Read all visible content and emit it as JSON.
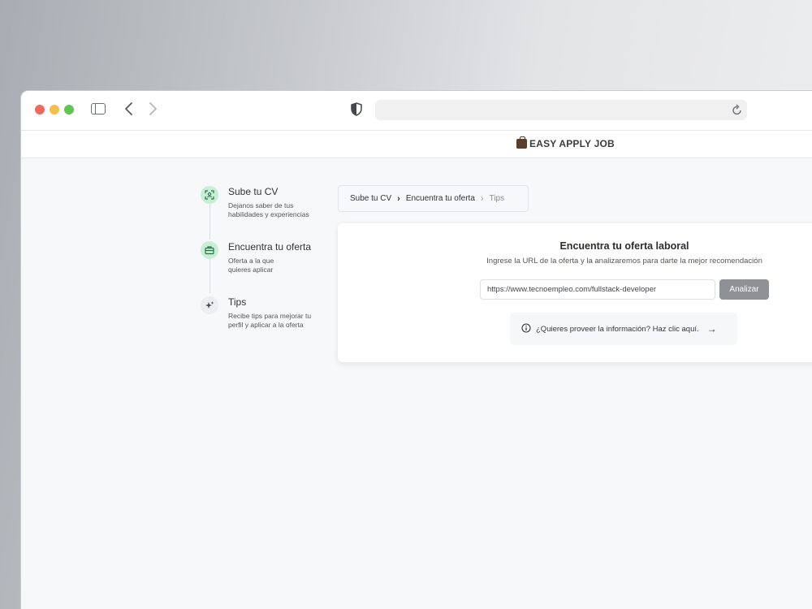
{
  "app": {
    "brand": "EASY APPLY JOB"
  },
  "steps": [
    {
      "title": "Sube tu CV",
      "desc_line1": "Dejanos saber de tus",
      "desc_line2": "habilidades y experiencias",
      "icon": "scan-person-icon"
    },
    {
      "title": "Encuentra tu oferta",
      "desc_line1": "Oferta a la que",
      "desc_line2": "quieres aplicar",
      "icon": "briefcase-icon"
    },
    {
      "title": "Tips",
      "desc_line1": "Recibe tips para mejorar tu",
      "desc_line2": "perfil y aplicar a la oferta",
      "icon": "sparkles-icon"
    }
  ],
  "breadcrumb": {
    "item1": "Sube tu CV",
    "item2": "Encuentra tu oferta",
    "item3": "Tips"
  },
  "card": {
    "title": "Encuentra tu oferta laboral",
    "subtitle": "Ingrese la URL de la oferta y la analizaremos para darte la mejor recomendación",
    "url_value": "https://www.tecnoempleo.com/fullstack-developer",
    "analyze_label": "Analizar",
    "info_text": "¿Quieres proveer la información? Haz clic aquí."
  },
  "colors": {
    "accent_green": "#c6efd6",
    "button_gray": "#8e9196"
  }
}
